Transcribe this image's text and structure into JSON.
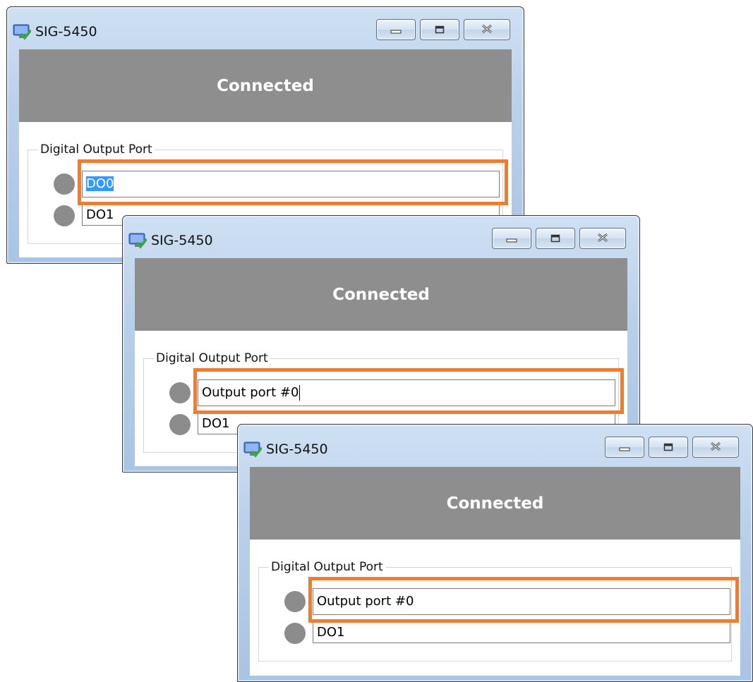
{
  "windows": [
    {
      "title": "SIG-5450",
      "status": "Connected",
      "group_label": "Digital Output Port",
      "ports": [
        {
          "value": "DO0",
          "state": "selected",
          "highlighted": true
        },
        {
          "value": "DO1"
        }
      ]
    },
    {
      "title": "SIG-5450",
      "status": "Connected",
      "group_label": "Digital Output Port",
      "ports": [
        {
          "value": "Output port #0",
          "state": "editing",
          "highlighted": true
        },
        {
          "value": "DO1"
        }
      ]
    },
    {
      "title": "SIG-5450",
      "status": "Connected",
      "group_label": "Digital Output Port",
      "ports": [
        {
          "value": "Output port #0",
          "state": "committed",
          "highlighted": true
        },
        {
          "value": "DO1"
        }
      ]
    }
  ],
  "icons": {
    "app": "monitor-check-icon",
    "minimize": "minimize-icon",
    "maximize": "maximize-icon",
    "close": "close-icon",
    "led": "led-indicator"
  },
  "colors": {
    "banner": "#8e8e8e",
    "highlight": "#ed7d31",
    "led": "#8c8c8c",
    "selection": "#3399ff"
  }
}
